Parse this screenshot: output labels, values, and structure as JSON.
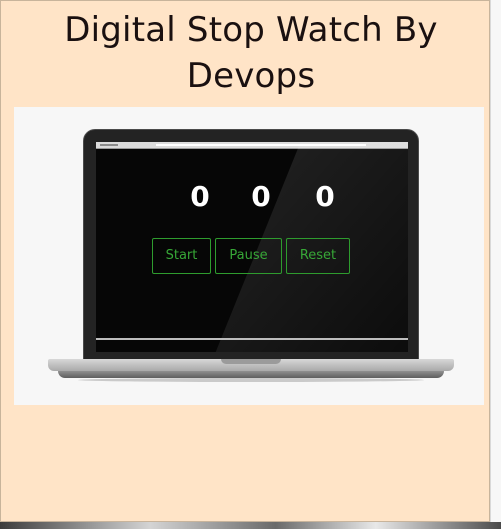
{
  "page": {
    "title": "Digital Stop Watch By Devops"
  },
  "stopwatch": {
    "digits": [
      "0",
      "0",
      "0"
    ],
    "buttons": {
      "start": "Start",
      "pause": "Pause",
      "reset": "Reset"
    }
  },
  "colors": {
    "background": "#ffe4c7",
    "button_border": "#2e9c2e",
    "button_text": "#37a737",
    "digit": "#ffffff",
    "screen": "#060606"
  }
}
